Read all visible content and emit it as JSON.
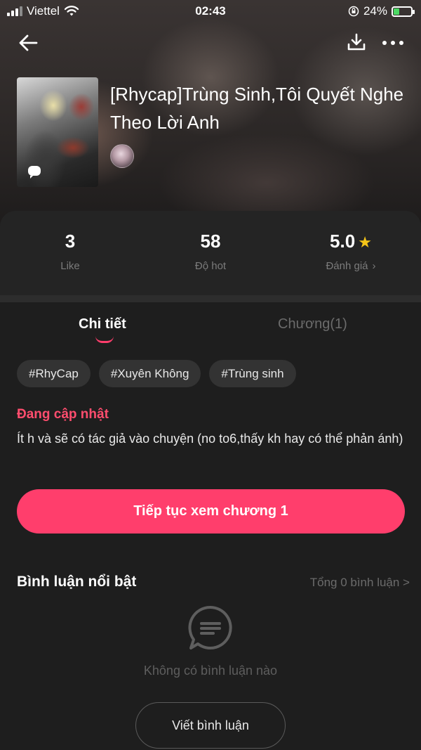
{
  "status_bar": {
    "carrier": "Viettel",
    "time": "02:43",
    "battery": "24%"
  },
  "book": {
    "title": "[Rhycap]Trùng Sinh,Tôi Quyết Nghe Theo Lời Anh"
  },
  "stats": {
    "like_value": "3",
    "like_label": "Like",
    "hot_value": "58",
    "hot_label": "Độ hot",
    "rating_value": "5.0",
    "rating_label": "Đánh giá",
    "rating_chevron": "›"
  },
  "tabs": {
    "detail": "Chi tiết",
    "chapters": "Chương(1)"
  },
  "tags": [
    "#RhyCap",
    "#Xuyên Không",
    "#Trùng sinh"
  ],
  "status_text": "Đang cập nhật",
  "description": "Ít h và sẽ có tác giả vào chuyện (no to6,thấy kh hay có thể phản ánh)",
  "continue_button": "Tiếp tục xem chương 1",
  "comments": {
    "title": "Bình luận nổi bật",
    "total": "Tổng 0 bình luận >",
    "empty": "Không có bình luận nào",
    "write_button": "Viết bình luận"
  },
  "colors": {
    "accent": "#ff3e6c",
    "star": "#f5c518",
    "background": "#1e1e1e"
  },
  "icons": {
    "back": "back-arrow-icon",
    "download": "download-icon",
    "more": "more-icon",
    "star": "star-icon",
    "comment": "comment-bubble-icon"
  }
}
